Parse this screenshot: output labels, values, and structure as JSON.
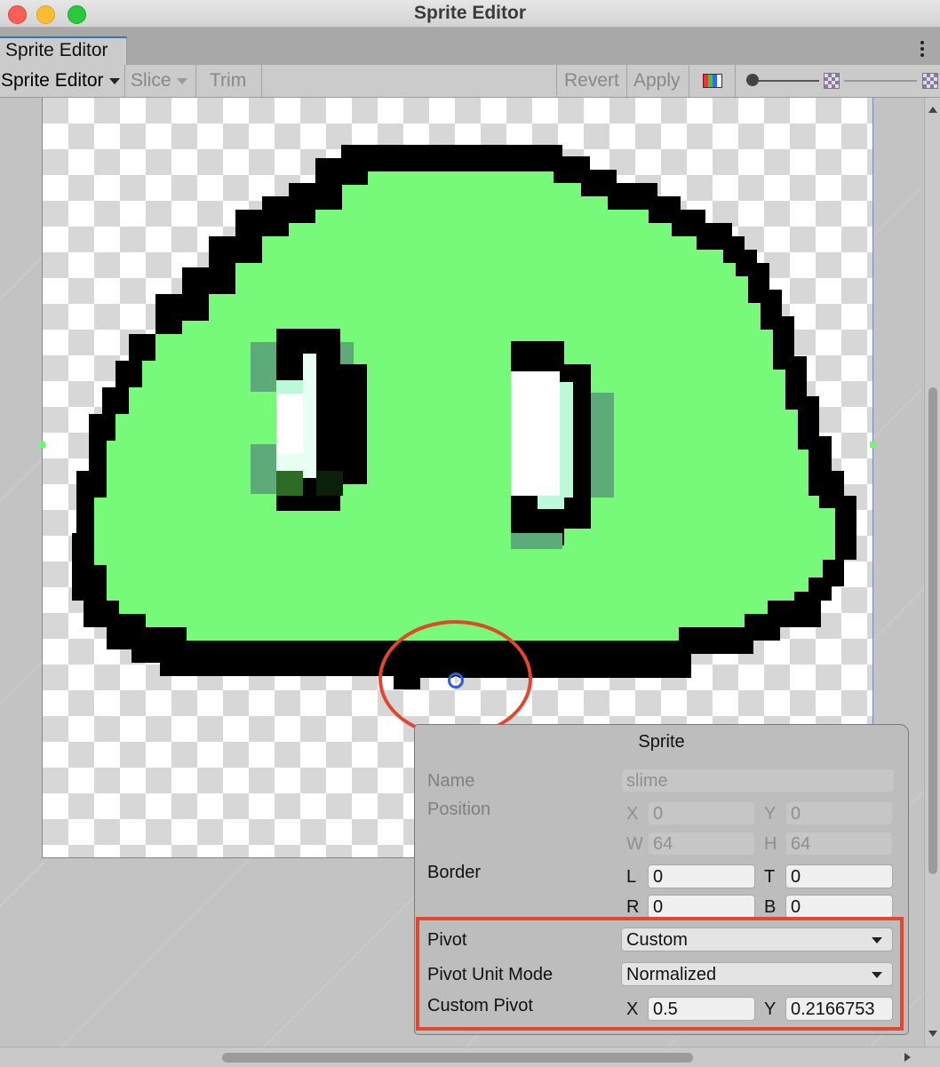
{
  "window": {
    "title": "Sprite Editor"
  },
  "tab": {
    "label": "Sprite Editor"
  },
  "toolbar": {
    "mode_label": "Sprite Editor",
    "slice_label": "Slice",
    "trim_label": "Trim",
    "revert_label": "Revert",
    "apply_label": "Apply"
  },
  "inspector": {
    "title": "Sprite",
    "name_label": "Name",
    "name_value": "slime",
    "position_label": "Position",
    "position": {
      "x_label": "X",
      "x": "0",
      "y_label": "Y",
      "y": "0",
      "w_label": "W",
      "w": "64",
      "h_label": "H",
      "h": "64"
    },
    "border_label": "Border",
    "border": {
      "l_label": "L",
      "l": "0",
      "t_label": "T",
      "t": "0",
      "r_label": "R",
      "r": "0",
      "b_label": "B",
      "b": "0"
    },
    "pivot_label": "Pivot",
    "pivot_value": "Custom",
    "pivot_unit_label": "Pivot Unit Mode",
    "pivot_unit_value": "Normalized",
    "custom_pivot_label": "Custom Pivot",
    "custom_pivot": {
      "x_label": "X",
      "x": "0.5",
      "y_label": "Y",
      "y": "0.2166753"
    }
  },
  "colors": {
    "highlight": "#e2462f",
    "slime": "#77f979",
    "outline": "#000000"
  },
  "icons": [
    "kebab-menu-icon",
    "color-channel-icon",
    "zoom-slider",
    "mip-level-icon",
    "pivot-handle-icon"
  ]
}
